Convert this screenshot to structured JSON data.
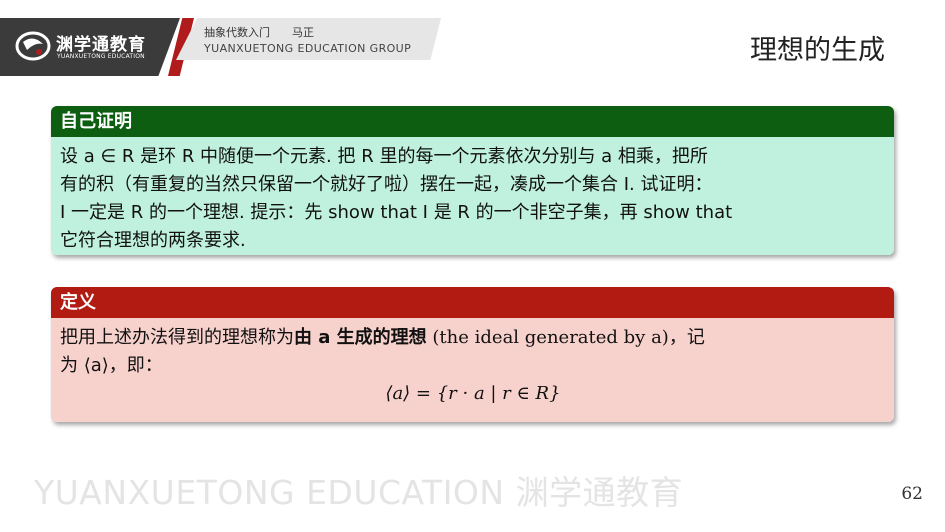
{
  "header": {
    "logo_cn": "渊学通教育",
    "logo_en": "YUANXUETONG EDUCATION",
    "course": "抽象代数入门",
    "author": "马正",
    "group": "YUANXUETONG EDUCATION GROUP",
    "slide_title": "理想的生成"
  },
  "exercise": {
    "heading": "自己证明",
    "lines": [
      "设 a ∈ R 是环 R 中随便一个元素. 把 R 里的每一个元素依次分别与 a 相乘，把所",
      "有的积（有重复的当然只保留一个就好了啦）摆在一起，凑成一个集合 I. 试证明：",
      "I 一定是 R 的一个理想. 提示：先 show that I 是 R 的一个非空子集，再 show that",
      "它符合理想的两条要求."
    ]
  },
  "definition": {
    "heading": "定义",
    "line1_a": "把用上述办法得到的理想称为",
    "line1_bold": "由 a 生成的理想",
    "line1_b": " (the ideal generated by a)，记",
    "line2": "为 ⟨a⟩，即：",
    "formula": "⟨a⟩ = {r · a | r ∈ R}"
  },
  "footer": {
    "watermark": "YUANXUETONG EDUCATION 渊学通教育",
    "page_number": "62"
  },
  "colors": {
    "exercise_head": "#0e5e12",
    "exercise_body": "#bff1de",
    "definition_head": "#b21b12",
    "definition_body": "#f7d1cc",
    "header_dark": "#3b3b3b",
    "header_red": "#b01c1c"
  }
}
